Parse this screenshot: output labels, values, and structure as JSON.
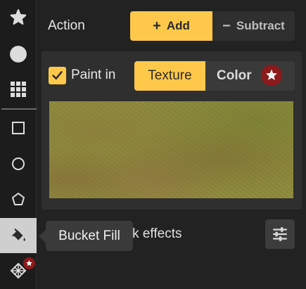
{
  "toolbar": {
    "tools": [
      {
        "name": "star-stamp-tool",
        "icon": "star-icon"
      },
      {
        "name": "circle-brush-tool",
        "icon": "filled-circle-icon"
      },
      {
        "name": "grid-tool",
        "icon": "grid-icon"
      },
      {
        "name": "rectangle-tool",
        "icon": "square-outline-icon"
      },
      {
        "name": "ellipse-tool",
        "icon": "circle-outline-icon"
      },
      {
        "name": "polygon-tool",
        "icon": "pentagon-outline-icon"
      },
      {
        "name": "bucket-fill-tool",
        "icon": "paint-bucket-icon",
        "active": true
      },
      {
        "name": "pattern-tool",
        "icon": "pattern-grid-icon",
        "badge": "star-badge-icon"
      }
    ]
  },
  "action": {
    "label": "Action",
    "add_label": "Add",
    "add_icon": "+",
    "subtract_label": "Subtract",
    "subtract_icon": "−",
    "selected": "Add"
  },
  "paint": {
    "checkbox_checked": true,
    "label": "Paint in",
    "tabs": [
      "Texture",
      "Color"
    ],
    "selected_tab": "Texture"
  },
  "mask": {
    "label_visible": "ask effects"
  },
  "tooltip": {
    "text": "Bucket Fill"
  },
  "colors": {
    "accent": "#ffc84a",
    "badge": "#8b1a1a",
    "panel": "#2f2f2f",
    "background": "#222222"
  }
}
